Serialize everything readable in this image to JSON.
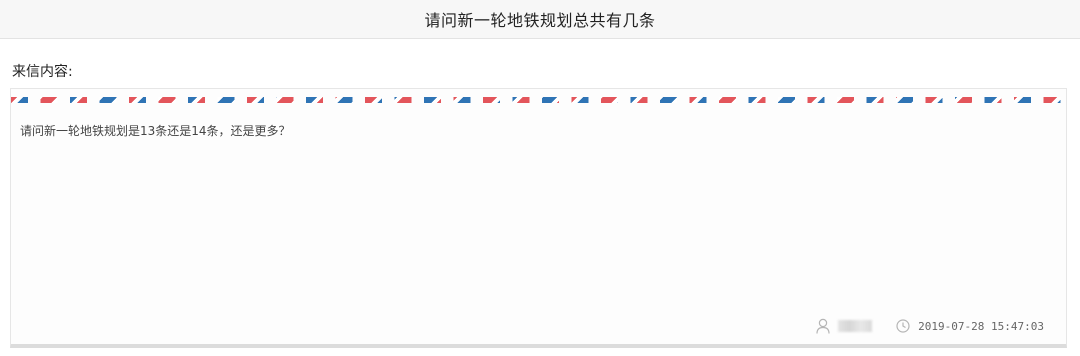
{
  "header": {
    "title": "请问新一轮地铁规划总共有几条"
  },
  "letter": {
    "section_label": "来信内容:",
    "body": "请问新一轮地铁规划是13条还是14条，还是更多？",
    "author": "",
    "timestamp": "2019-07-28 15:47:03"
  },
  "colors": {
    "stripe_red": "#e3555b",
    "stripe_blue": "#2f74b5"
  },
  "icons": [
    "user-icon",
    "clock-icon"
  ]
}
